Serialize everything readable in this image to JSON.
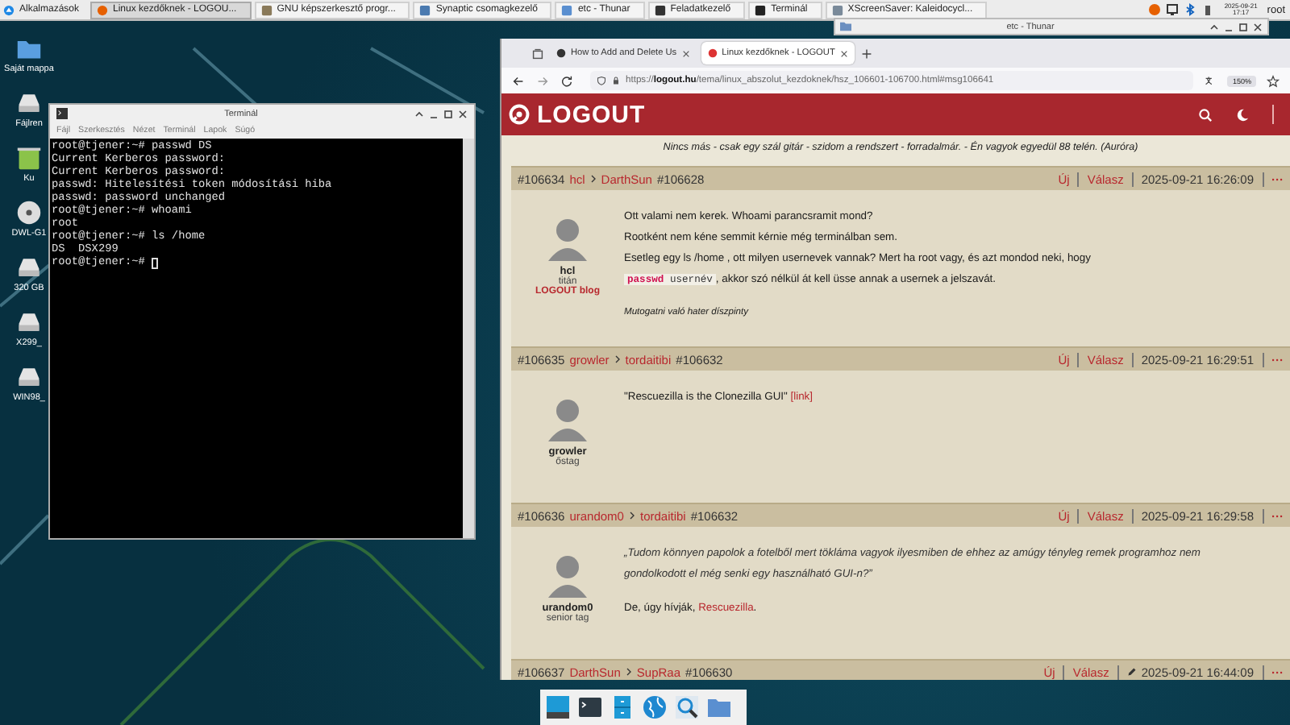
{
  "panel": {
    "menu_label": "Alkalmazások",
    "tasks": [
      {
        "title": "Linux kezdőknek - LOGOU...",
        "kind": "browser",
        "selected": true
      },
      {
        "title": "GNU képszerkesztő progr...",
        "kind": "gimp",
        "selected": false
      },
      {
        "title": "Synaptic csomagkezelő",
        "kind": "package",
        "selected": false
      },
      {
        "title": "etc - Thunar",
        "kind": "folder",
        "selected": false
      },
      {
        "title": "Feladatkezelő",
        "kind": "monitor",
        "selected": false
      },
      {
        "title": "Terminál",
        "kind": "terminal",
        "selected": false
      },
      {
        "title": "XScreenSaver: Kaleidocycl...",
        "kind": "screensaver",
        "selected": false
      }
    ],
    "clock": {
      "date": "2025-09-21",
      "time": "17:17"
    },
    "user": "root"
  },
  "desktop_icons": [
    {
      "label": "Saját mappa",
      "kind": "home"
    },
    {
      "label": "Fájlren",
      "kind": "drive"
    },
    {
      "label": "Ku",
      "kind": "trash"
    },
    {
      "label": "DWL-G1",
      "kind": "disc"
    },
    {
      "label": "320 GB",
      "kind": "drive"
    },
    {
      "label": "X299_",
      "kind": "drive"
    },
    {
      "label": "WIN98_",
      "kind": "drive"
    }
  ],
  "thunar": {
    "title": "etc - Thunar"
  },
  "terminal": {
    "title": "Terminál",
    "menu": [
      "Fájl",
      "Szerkesztés",
      "Nézet",
      "Terminál",
      "Lapok",
      "Súgó"
    ],
    "lines": [
      "root@tjener:~# passwd DS",
      "Current Kerberos password:",
      "Current Kerberos password:",
      "passwd: Hitelesítési token módosítási hiba",
      "passwd: password unchanged",
      "root@tjener:~# whoami",
      "root",
      "root@tjener:~# ls /home",
      "DS  DSX299",
      "root@tjener:~# "
    ]
  },
  "browser": {
    "tabs": [
      {
        "title": "How to Add and Delete Us",
        "selected": false
      },
      {
        "title": "Linux kezdőknek - LOGOUT",
        "selected": true
      }
    ],
    "url": "https://**logout.hu**/tema/linux_abszolut_kezdoknek/hsz_106601-106700.html#msg106641",
    "zoom": "150%",
    "site": {
      "logo": "LOGOUT",
      "motto": "Nincs más - csak egy szál gitár - szidom a rendszert - forradalmár. - Én vagyok egyedül 88 telén. (Auróra)",
      "posts": [
        {
          "number": "#106634",
          "author": "hcl",
          "reply_to": "DarthSun",
          "reply_number": "#106628",
          "new_label": "Új",
          "reply_label": "Válasz",
          "date": "2025-09-21 16:26:09",
          "more": "···",
          "edited": false,
          "user": {
            "name": "hcl",
            "rank": "titán",
            "blog": "LOGOUT blog"
          },
          "paragraphs": [
            {
              "kind": "text",
              "segments": [
                {
                  "kind": "text",
                  "text": "Ott valami nem kerek. Whoami parancsramit mond?"
                }
              ]
            },
            {
              "kind": "text",
              "segments": [
                {
                  "kind": "text",
                  "text": "Rootként nem kéne semmit kérnie még terminálban sem."
                }
              ]
            },
            {
              "kind": "text",
              "segments": [
                {
                  "kind": "text",
                  "text": "Esetleg egy ls /home , ott milyen usernevek vannak? Mert ha root vagy, és azt mondod neki, hogy"
                }
              ]
            },
            {
              "kind": "text",
              "segments": [
                {
                  "kind": "code",
                  "command": "passwd",
                  "argument": "usernév"
                },
                {
                  "kind": "text",
                  "text": ", akkor szó nélkül át kell üsse annak a usernek a jelszavát."
                }
              ]
            }
          ],
          "signature": "Mutogatni való hater díszpinty"
        },
        {
          "number": "#106635",
          "author": "growler",
          "reply_to": "tordaitibi",
          "reply_number": "#106632",
          "new_label": "Új",
          "reply_label": "Válasz",
          "date": "2025-09-21 16:29:51",
          "more": "···",
          "edited": false,
          "user": {
            "name": "growler",
            "rank": "őstag"
          },
          "paragraphs": [
            {
              "kind": "text",
              "segments": [
                {
                  "kind": "text",
                  "text": "\"Rescuezilla is the Clonezilla GUI\" "
                },
                {
                  "kind": "link",
                  "text": "[link]"
                }
              ]
            }
          ]
        },
        {
          "number": "#106636",
          "author": "urandom0",
          "reply_to": "tordaitibi",
          "reply_number": "#106632",
          "new_label": "Új",
          "reply_label": "Válasz",
          "date": "2025-09-21 16:29:58",
          "more": "···",
          "edited": false,
          "user": {
            "name": "urandom0",
            "rank": "senior tag"
          },
          "paragraphs": [
            {
              "kind": "quote",
              "segments": [
                {
                  "kind": "text",
                  "text": "„Tudom könnyen papolok a fotelből mert tökláma vagyok ilyesmiben de ehhez az amúgy tényleg remek programhoz nem gondolkodott el még senki egy használható GUI-n?”"
                }
              ]
            },
            {
              "kind": "text",
              "segments": [
                {
                  "kind": "text",
                  "text": "De, úgy hívják, "
                },
                {
                  "kind": "link",
                  "text": "Rescuezilla"
                },
                {
                  "kind": "text",
                  "text": "."
                }
              ]
            }
          ]
        },
        {
          "number": "#106637",
          "author": "DarthSun",
          "reply_to": "SupRaa",
          "reply_number": "#106630",
          "new_label": "Új",
          "reply_label": "Válasz",
          "date": "2025-09-21 16:44:09",
          "more": "···",
          "edited": true
        }
      ]
    }
  }
}
